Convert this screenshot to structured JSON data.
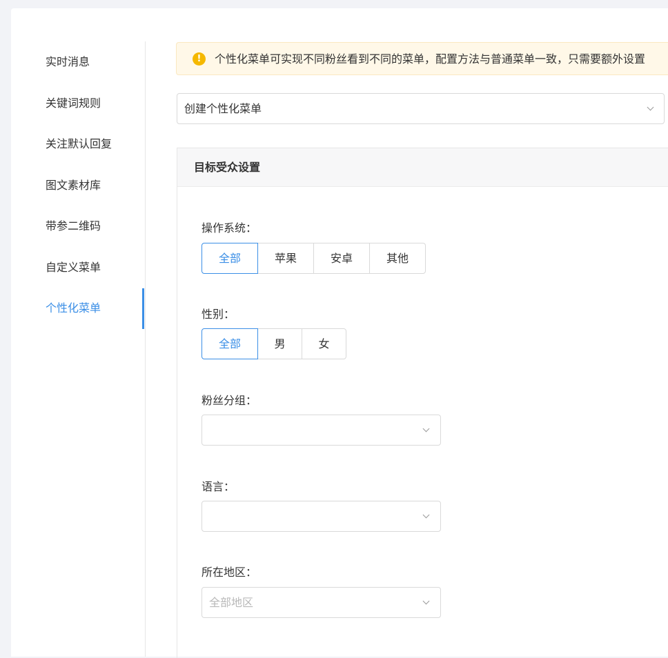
{
  "sidebar": {
    "items": [
      {
        "label": "实时消息",
        "active": false
      },
      {
        "label": "关键词规则",
        "active": false
      },
      {
        "label": "关注默认回复",
        "active": false
      },
      {
        "label": "图文素材库",
        "active": false
      },
      {
        "label": "带参二维码",
        "active": false
      },
      {
        "label": "自定义菜单",
        "active": false
      },
      {
        "label": "个性化菜单",
        "active": true
      }
    ]
  },
  "colors": {
    "accent": "#3a8ee6",
    "warning": "#f5b800",
    "alert_bg": "#fff8e8"
  },
  "alert": {
    "icon": "warning-icon",
    "text": "个性化菜单可实现不同粉丝看到不同的菜单，配置方法与普通菜单一致，只需要额外设置"
  },
  "menu_select": {
    "value": "创建个性化菜单"
  },
  "panel": {
    "title": "目标受众设置"
  },
  "os": {
    "label": "操作系统：",
    "options": [
      "全部",
      "苹果",
      "安卓",
      "其他"
    ],
    "selected": "全部"
  },
  "gender": {
    "label": "性别：",
    "options": [
      "全部",
      "男",
      "女"
    ],
    "selected": "全部"
  },
  "fans_group": {
    "label": "粉丝分组：",
    "value": ""
  },
  "language": {
    "label": "语言：",
    "value": ""
  },
  "region": {
    "label": "所在地区：",
    "placeholder": "全部地区"
  }
}
